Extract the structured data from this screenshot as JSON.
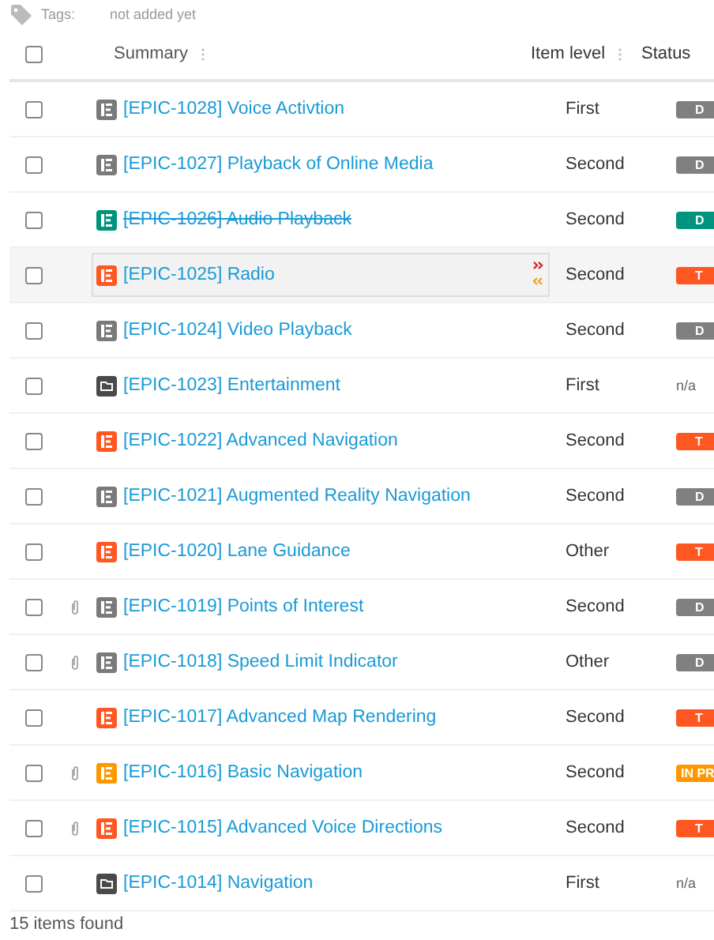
{
  "tags": {
    "label": "Tags:",
    "value": "not added yet"
  },
  "table": {
    "columns": [
      {
        "label": "Summary"
      },
      {
        "label": "Item level"
      },
      {
        "label": "Status"
      }
    ],
    "header_checkbox": {
      "checked": false
    },
    "rows": [
      {
        "summary": "[EPIC-1028] Voice Activtion",
        "kind": "epic",
        "color": "#7a7a7a",
        "level": "First",
        "status": {
          "kind": "badge",
          "label": "D",
          "color": "#808080"
        },
        "attachment": false,
        "resolved": false,
        "hovered": false,
        "checked": false
      },
      {
        "summary": "[EPIC-1027] Playback of Online Media",
        "kind": "epic",
        "color": "#7a7a7a",
        "level": "Second",
        "status": {
          "kind": "badge",
          "label": "D",
          "color": "#808080"
        },
        "attachment": false,
        "resolved": false,
        "hovered": false,
        "checked": false
      },
      {
        "summary": "[EPIC-1026] Audio Playback",
        "kind": "epic",
        "color": "#00947e",
        "level": "Second",
        "status": {
          "kind": "badge",
          "label": "D",
          "color": "#00947e"
        },
        "attachment": false,
        "resolved": true,
        "hovered": false,
        "checked": false
      },
      {
        "summary": "[EPIC-1025] Radio",
        "kind": "epic",
        "color": "#ff5722",
        "level": "Second",
        "status": {
          "kind": "badge",
          "label": "T",
          "color": "#ff5722"
        },
        "attachment": false,
        "resolved": false,
        "hovered": true,
        "checked": false
      },
      {
        "summary": "[EPIC-1024] Video Playback",
        "kind": "epic",
        "color": "#7a7a7a",
        "level": "Second",
        "status": {
          "kind": "badge",
          "label": "D",
          "color": "#808080"
        },
        "attachment": false,
        "resolved": false,
        "hovered": false,
        "checked": false
      },
      {
        "summary": "[EPIC-1023] Entertainment",
        "kind": "folder",
        "color": "#4a4a4a",
        "level": "First",
        "status": {
          "kind": "text",
          "label": "n/a"
        },
        "attachment": false,
        "resolved": false,
        "hovered": false,
        "checked": false
      },
      {
        "summary": "[EPIC-1022] Advanced Navigation",
        "kind": "epic",
        "color": "#ff5722",
        "level": "Second",
        "status": {
          "kind": "badge",
          "label": "T",
          "color": "#ff5722"
        },
        "attachment": false,
        "resolved": false,
        "hovered": false,
        "checked": false
      },
      {
        "summary": "[EPIC-1021] Augmented Reality Navigation",
        "kind": "epic",
        "color": "#7a7a7a",
        "level": "Second",
        "status": {
          "kind": "badge",
          "label": "D",
          "color": "#808080"
        },
        "attachment": false,
        "resolved": false,
        "hovered": false,
        "checked": false
      },
      {
        "summary": "[EPIC-1020] Lane Guidance",
        "kind": "epic",
        "color": "#ff5722",
        "level": "Other",
        "status": {
          "kind": "badge",
          "label": "T",
          "color": "#ff5722"
        },
        "attachment": false,
        "resolved": false,
        "hovered": false,
        "checked": false
      },
      {
        "summary": "[EPIC-1019] Points of Interest",
        "kind": "epic",
        "color": "#7a7a7a",
        "level": "Second",
        "status": {
          "kind": "badge",
          "label": "D",
          "color": "#808080"
        },
        "attachment": true,
        "resolved": false,
        "hovered": false,
        "checked": false
      },
      {
        "summary": "[EPIC-1018] Speed Limit Indicator",
        "kind": "epic",
        "color": "#7a7a7a",
        "level": "Other",
        "status": {
          "kind": "badge",
          "label": "D",
          "color": "#808080"
        },
        "attachment": true,
        "resolved": false,
        "hovered": false,
        "checked": false
      },
      {
        "summary": "[EPIC-1017] Advanced Map Rendering",
        "kind": "epic",
        "color": "#ff5722",
        "level": "Second",
        "status": {
          "kind": "badge",
          "label": "T",
          "color": "#ff5722"
        },
        "attachment": false,
        "resolved": false,
        "hovered": false,
        "checked": false
      },
      {
        "summary": "[EPIC-1016] Basic Navigation",
        "kind": "epic",
        "color": "#ff9800",
        "level": "Second",
        "status": {
          "kind": "badge",
          "label": "IN PR",
          "color": "#ff9800"
        },
        "attachment": true,
        "resolved": false,
        "hovered": false,
        "checked": false
      },
      {
        "summary": "[EPIC-1015] Advanced Voice Directions",
        "kind": "epic",
        "color": "#ff5722",
        "level": "Second",
        "status": {
          "kind": "badge",
          "label": "T",
          "color": "#ff5722"
        },
        "attachment": true,
        "resolved": false,
        "hovered": false,
        "checked": false
      },
      {
        "summary": "[EPIC-1014] Navigation",
        "kind": "folder",
        "color": "#4a4a4a",
        "level": "First",
        "status": {
          "kind": "text",
          "label": "n/a"
        },
        "attachment": false,
        "resolved": false,
        "hovered": false,
        "checked": false
      }
    ]
  },
  "footer": {
    "count": "15 items found"
  }
}
